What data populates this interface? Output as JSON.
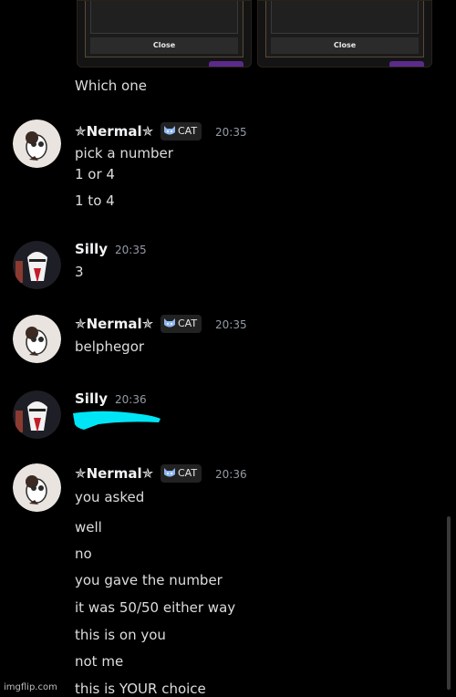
{
  "embeds": [
    {
      "close_label": "Close"
    },
    {
      "close_label": "Close"
    }
  ],
  "intro_line": "Which one",
  "messages": [
    {
      "username": "✯Nermal✯",
      "tag": "CAT",
      "time": "20:35",
      "lines": [
        "pick a number",
        "1 or 4",
        "1 to 4"
      ]
    },
    {
      "username": "Silly",
      "time": "20:35",
      "lines": [
        "3"
      ]
    },
    {
      "username": "✯Nermal✯",
      "tag": "CAT",
      "time": "20:35",
      "lines": [
        "belphegor"
      ]
    },
    {
      "username": "Silly",
      "time": "20:36",
      "redacted": true
    },
    {
      "username": "✯Nermal✯",
      "tag": "CAT",
      "time": "20:36",
      "lines": [
        "you asked",
        "well",
        "no",
        "you gave the number",
        "it was 50/50 either way",
        "this is on you",
        "not me",
        "this is YOUR choice"
      ]
    }
  ],
  "watermark": "imgflip.com",
  "colors": {
    "redaction": "#00e5f5",
    "tag_bg": "#222222",
    "background": "#000000"
  }
}
